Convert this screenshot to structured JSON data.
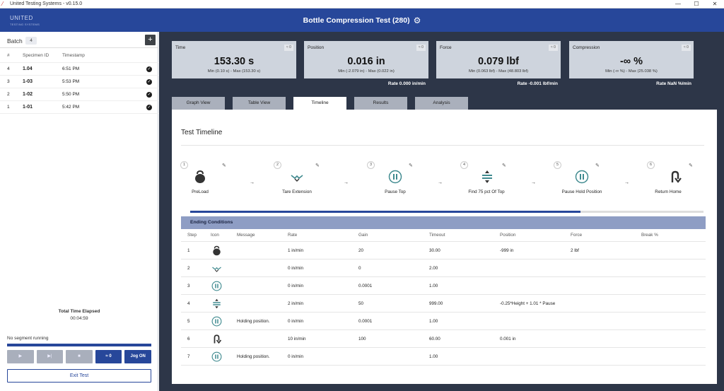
{
  "window": {
    "title": "United Testing Systems - v0.15.0",
    "controls": [
      "—",
      "☐",
      "✕"
    ]
  },
  "header": {
    "logo_main": "UNITED",
    "logo_sub": "TESTING SYSTEMS",
    "title": "Bottle Compression Test (280)"
  },
  "sidebar": {
    "batch_label": "Batch",
    "batch_count": "4",
    "add_label": "+",
    "columns": [
      "#",
      "Specimen ID",
      "Timestamp"
    ],
    "rows": [
      {
        "num": "4",
        "id": "1.04",
        "time": "6:51 PM"
      },
      {
        "num": "3",
        "id": "1-03",
        "time": "5:53 PM"
      },
      {
        "num": "2",
        "id": "1-02",
        "time": "5:50 PM"
      },
      {
        "num": "1",
        "id": "1-01",
        "time": "5:42 PM"
      }
    ],
    "elapsed_label": "Total Time Elapsed",
    "elapsed_value": "00:04:59",
    "segment_status": "No segment running",
    "controls": {
      "play": "▶",
      "next": "▶|",
      "stop": "■",
      "zero": "≈ 0",
      "jog": "Jog ON"
    },
    "exit_label": "Exit Test"
  },
  "cards": [
    {
      "label": "Time",
      "zero": "≈ 0",
      "value": "153.30 s",
      "minmax": "Min (0.10 s) - Max (153.30 s)",
      "rate": ""
    },
    {
      "label": "Position",
      "zero": "≈ 0",
      "value": "0.016 in",
      "minmax": "Min (-2.079 in) - Max (0.022 in)",
      "rate": "Rate 0.000 in/min"
    },
    {
      "label": "Force",
      "zero": "≈ 0",
      "value": "0.079 lbf",
      "minmax": "Min (0.063 lbf) - Max (48.803 lbf)",
      "rate": "Rate -0.001 lbf/min"
    },
    {
      "label": "Compression",
      "zero": "≈ 0",
      "value": "-∞ %",
      "minmax": "Min (-∞ %) - Max (25.038 %)",
      "rate": "Rate NaN %/min"
    }
  ],
  "tabs": [
    "Graph View",
    "Table View",
    "Timeline",
    "Results",
    "Analysis"
  ],
  "active_tab": "Timeline",
  "timeline": {
    "title": "Test Timeline",
    "progress": 0.76,
    "steps": [
      {
        "num": "1",
        "name": "PreLoad",
        "icon": "kettlebell-icon"
      },
      {
        "num": "2",
        "name": "Tare Extension",
        "icon": "tare-icon"
      },
      {
        "num": "3",
        "name": "Pause Top",
        "icon": "pause-icon"
      },
      {
        "num": "4",
        "name": "Find 75 pct Of Top",
        "icon": "find-icon"
      },
      {
        "num": "5",
        "name": "Pause Hold Position",
        "icon": "pause-icon"
      },
      {
        "num": "6",
        "name": "Return Home",
        "icon": "return-icon"
      }
    ]
  },
  "ending": {
    "title": "Ending Conditions",
    "columns": [
      "Step",
      "Icon",
      "Message",
      "Rate",
      "Gain",
      "Timeout",
      "Position",
      "Force",
      "Break %"
    ],
    "rows": [
      {
        "step": "1",
        "icon": "kettlebell-icon",
        "message": "",
        "rate": "1 in/min",
        "gain": "20",
        "timeout": "30.00",
        "position": "-999 in",
        "force": "2 lbf",
        "break": ""
      },
      {
        "step": "2",
        "icon": "tare-icon",
        "message": "",
        "rate": "0 in/min",
        "gain": "0",
        "timeout": "2.00",
        "position": "",
        "force": "",
        "break": ""
      },
      {
        "step": "3",
        "icon": "pause-icon",
        "message": "",
        "rate": "0 in/min",
        "gain": "0.0001",
        "timeout": "1.00",
        "position": "",
        "force": "",
        "break": ""
      },
      {
        "step": "4",
        "icon": "find-icon",
        "message": "",
        "rate": "2 in/min",
        "gain": "50",
        "timeout": "999.00",
        "position": "-0.25*Height + 1.01 * Pause",
        "force": "",
        "break": ""
      },
      {
        "step": "5",
        "icon": "pause-icon",
        "message": "Holding position.",
        "rate": "0 in/min",
        "gain": "0.0001",
        "timeout": "1.00",
        "position": "",
        "force": "",
        "break": ""
      },
      {
        "step": "6",
        "icon": "return-icon",
        "message": "",
        "rate": "10 in/min",
        "gain": "100",
        "timeout": "60.00",
        "position": "0.001 in",
        "force": "",
        "break": ""
      },
      {
        "step": "7",
        "icon": "pause-icon",
        "message": "Holding position.",
        "rate": "0 in/min",
        "gain": "",
        "timeout": "1.00",
        "position": "",
        "force": "",
        "break": ""
      }
    ]
  },
  "colors": {
    "brand": "#27479a",
    "main_bg": "#2d3648",
    "card_bg": "#ced4dd",
    "teal": "#3f8a8f"
  }
}
